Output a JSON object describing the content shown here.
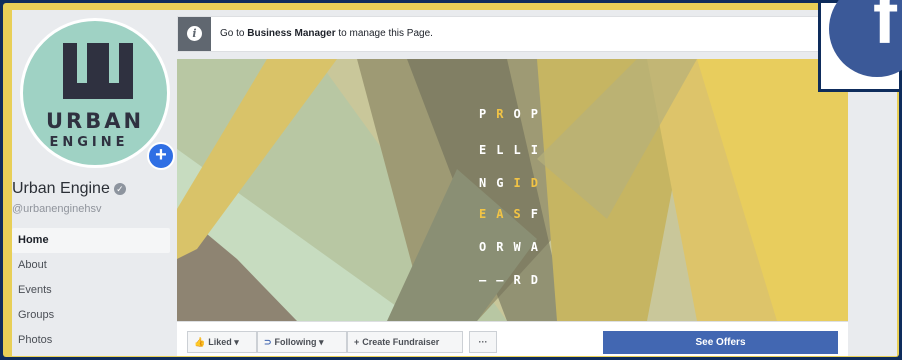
{
  "page": {
    "name": "Urban Engine",
    "handle": "@urbanenginehsv"
  },
  "logo": {
    "line1": "URBAN",
    "line2": "ENGINE"
  },
  "nav": {
    "items": [
      "Home",
      "About",
      "Events",
      "Groups",
      "Photos"
    ],
    "active": "Home"
  },
  "business_manager": {
    "prefix": "Go to ",
    "link": "Business Manager",
    "suffix": " to manage this Page."
  },
  "cover": {
    "lines": [
      [
        "P",
        "R",
        "O",
        "P"
      ],
      [
        "E",
        "L",
        "L",
        "I"
      ],
      [
        "N",
        "G",
        "I",
        "D"
      ],
      [
        "E",
        "A",
        "S",
        "F"
      ],
      [
        "O",
        "R",
        "W",
        "A"
      ],
      [
        "–",
        "–",
        "R",
        "D"
      ]
    ],
    "highlight_color": "#f2c445"
  },
  "actions": {
    "liked": "Liked ▾",
    "following": "Following ▾",
    "fundraiser": "Create Fundraiser",
    "more": "···",
    "offers": "See Offers"
  },
  "icons": {
    "info": "info-icon",
    "like": "thumbs-up-icon",
    "rss": "rss-icon",
    "plus": "plus-icon",
    "verified": "verified-badge-icon",
    "facebook": "facebook-logo-icon"
  },
  "colors": {
    "facebook_blue": "#3b5998",
    "button_blue": "#4267b2",
    "frame_yellow": "#e8cf57",
    "avatar_mint": "#9fd2c4"
  }
}
